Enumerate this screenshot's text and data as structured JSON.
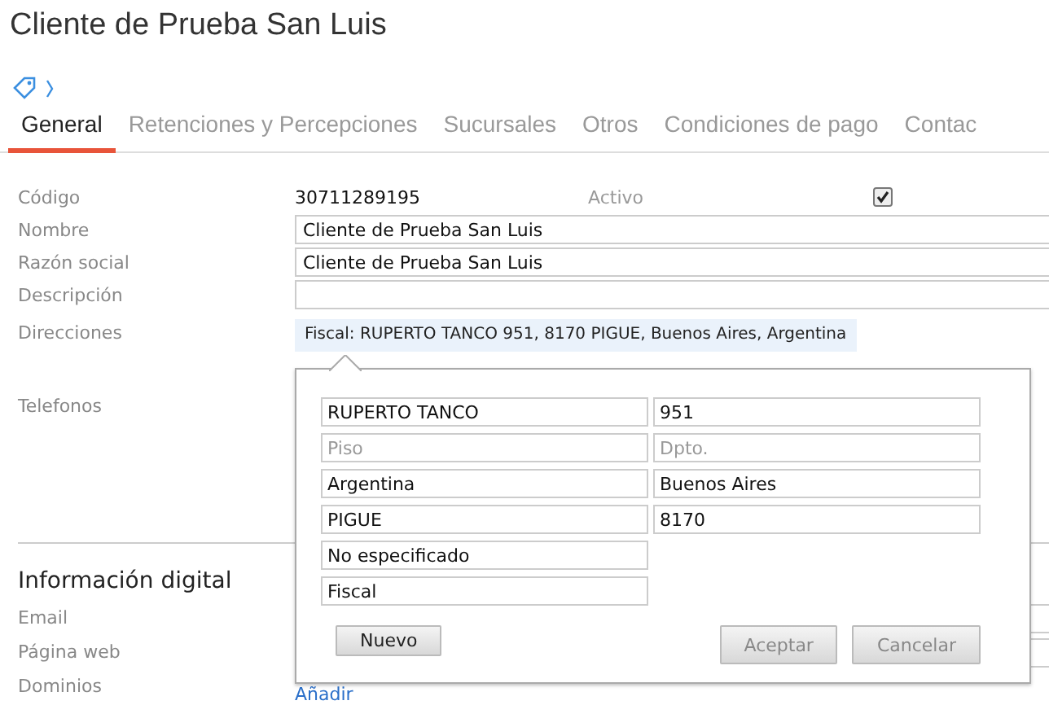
{
  "title": "Cliente de Prueba San Luis",
  "tabs": [
    {
      "label": "General",
      "selected": true
    },
    {
      "label": "Retenciones y Percepciones",
      "selected": false
    },
    {
      "label": "Sucursales",
      "selected": false
    },
    {
      "label": "Otros",
      "selected": false
    },
    {
      "label": "Condiciones de pago",
      "selected": false
    },
    {
      "label": "Contac",
      "selected": false
    }
  ],
  "codigo": {
    "label": "Código",
    "value": "30711289195"
  },
  "activo": {
    "label": "Activo",
    "checked": true
  },
  "fields": [
    {
      "label": "Nombre",
      "value": "Cliente de Prueba San Luis"
    },
    {
      "label": "Razón social",
      "value": "Cliente de Prueba San Luis"
    },
    {
      "label": "Descripción"
    }
  ],
  "direcciones": {
    "label": "Direcciones",
    "summary": "Fiscal: RUPERTO TANCO 951, 8170 PIGUE, Buenos Aires, Argentina"
  },
  "telefonos": {
    "label": "Telefonos"
  },
  "digital": {
    "heading": "Información digital",
    "fields": [
      {
        "label": "Email"
      },
      {
        "label": "Página web"
      }
    ],
    "dominios": {
      "label": "Dominios",
      "link": "Añadir"
    }
  },
  "address_editor": {
    "rows": [
      [
        {
          "value": "RUPERTO TANCO"
        },
        {
          "value": "951"
        }
      ],
      [
        {
          "placeholder": "Piso"
        },
        {
          "placeholder": "Dpto."
        }
      ],
      [
        {
          "value": "Argentina"
        },
        {
          "value": "Buenos Aires"
        }
      ],
      [
        {
          "value": "PIGUE"
        },
        {
          "value": "8170"
        }
      ],
      [
        {
          "value": "No especificado"
        }
      ],
      [
        {
          "value": "Fiscal"
        }
      ]
    ],
    "buttons": [
      {
        "label": "Nuevo",
        "disabled": false
      },
      {
        "label": "Aceptar",
        "disabled": true
      },
      {
        "label": "Cancelar",
        "disabled": true
      }
    ]
  }
}
